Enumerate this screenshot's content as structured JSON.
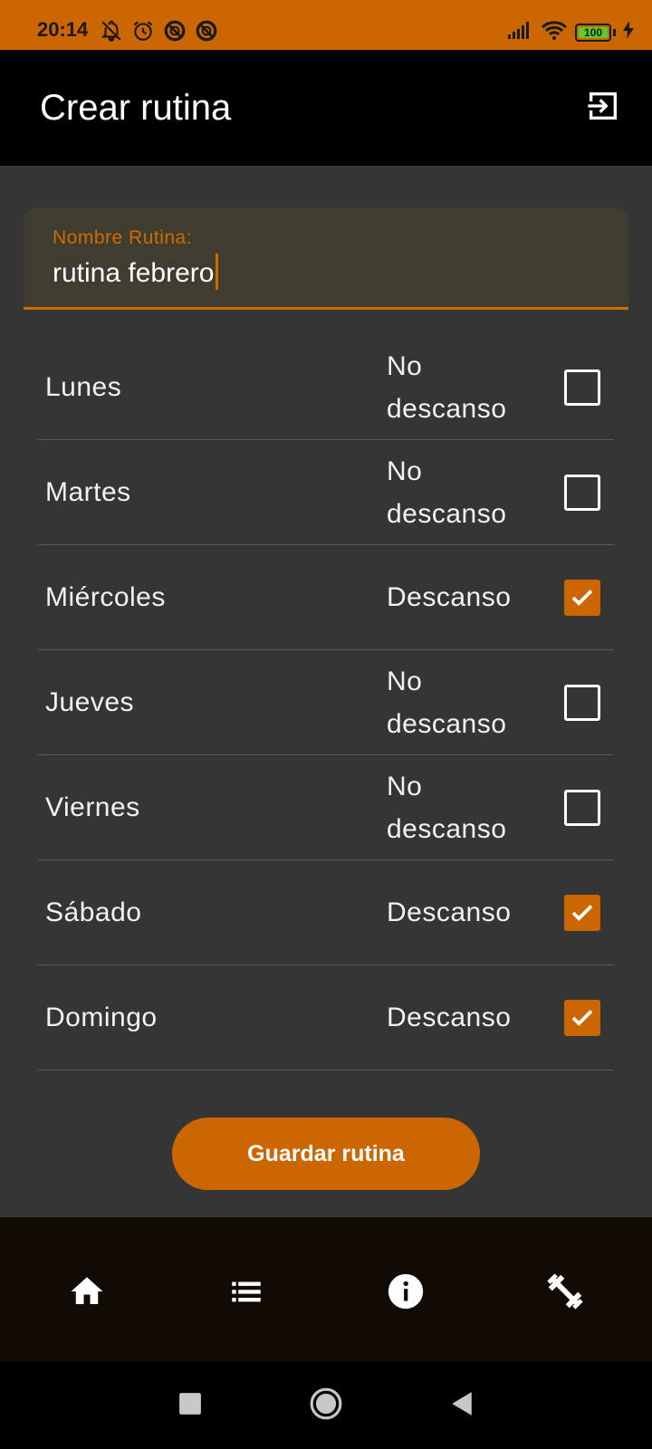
{
  "status_bar": {
    "time": "20:14",
    "battery": "100",
    "icons": [
      "bell-off-icon",
      "alarm-icon",
      "blocked-icon",
      "blocked-icon",
      "signal-icon",
      "wifi-icon",
      "battery-icon",
      "charging-icon"
    ]
  },
  "app_bar": {
    "title": "Crear rutina",
    "action_icon": "logout-icon"
  },
  "form": {
    "name_label": "Nombre Rutina:",
    "name_value": "rutina febrero"
  },
  "days": [
    {
      "name": "Lunes",
      "status": "No descanso",
      "checked": false
    },
    {
      "name": "Martes",
      "status": "No descanso",
      "checked": false
    },
    {
      "name": "Miércoles",
      "status": "Descanso",
      "checked": true
    },
    {
      "name": "Jueves",
      "status": "No descanso",
      "checked": false
    },
    {
      "name": "Viernes",
      "status": "No descanso",
      "checked": false
    },
    {
      "name": "Sábado",
      "status": "Descanso",
      "checked": true
    },
    {
      "name": "Domingo",
      "status": "Descanso",
      "checked": true
    }
  ],
  "actions": {
    "save_label": "Guardar rutina"
  },
  "bottom_nav": {
    "items": [
      "home-icon",
      "list-icon",
      "info-icon",
      "dumbbell-icon"
    ]
  },
  "system_nav": {
    "items": [
      "recents-icon",
      "home-circle-icon",
      "back-icon"
    ]
  },
  "colors": {
    "accent": "#cc6600",
    "background": "#353535",
    "app_bar": "#000000",
    "bottom_nav": "#120a04",
    "field_background": "#3e3d30"
  }
}
